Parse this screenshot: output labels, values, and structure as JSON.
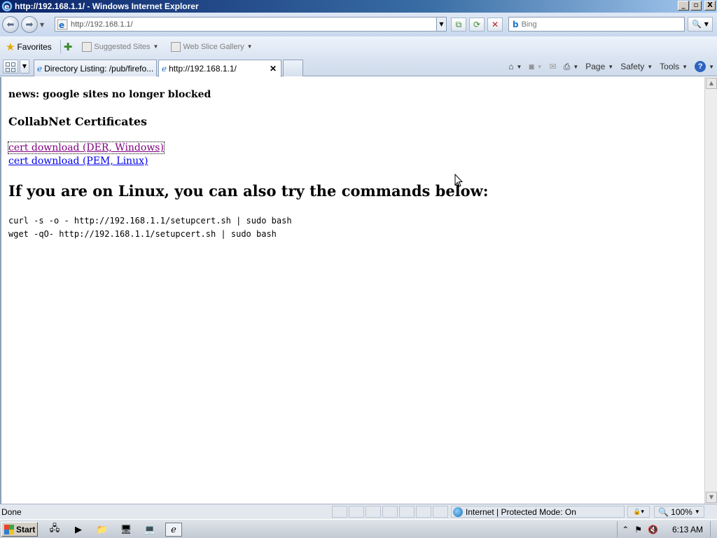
{
  "window": {
    "title": "http://192.168.1.1/ - Windows Internet Explorer",
    "minimize": "_",
    "maximize": "▫",
    "close": "X"
  },
  "address": {
    "url": "http://192.168.1.1/",
    "search_placeholder": "Bing"
  },
  "favorites": {
    "label": "Favorites",
    "suggested_sites": "Suggested Sites",
    "web_slice_gallery": "Web Slice Gallery"
  },
  "tabs": [
    {
      "label": "Directory Listing: /pub/firefo...",
      "active": false
    },
    {
      "label": "http://192.168.1.1/",
      "active": true
    }
  ],
  "command_bar": {
    "page": "Page",
    "safety": "Safety",
    "tools": "Tools",
    "help": "?"
  },
  "content": {
    "news": "news: google sites no longer blocked",
    "heading_certs": "CollabNet Certificates",
    "link_der": "cert download (DER, Windows)",
    "link_pem": "cert download (PEM, Linux)",
    "heading_linux": "If you are on Linux, you can also try the commands below:",
    "cmd_curl": "curl -s -o - http://192.168.1.1/setupcert.sh | sudo bash",
    "cmd_wget": "wget -qO- http://192.168.1.1/setupcert.sh | sudo bash"
  },
  "statusbar": {
    "status": "Done",
    "zone": "Internet | Protected Mode: On",
    "zoom": "100%"
  },
  "taskbar": {
    "start": "Start",
    "clock": "6:13 AM"
  },
  "colors": {
    "visited_link": "#800080",
    "link": "#0000ee",
    "title_bar": "#0a246a"
  }
}
